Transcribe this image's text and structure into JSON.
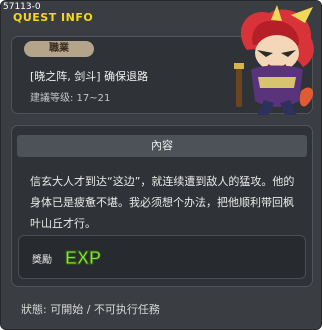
{
  "window": {
    "top_id": "57113-0",
    "title": "QUEST INFO"
  },
  "job": {
    "badge": "職業",
    "quest_name": "[晓之阵, 剑斗] 确保退路",
    "level_range": "建議等级: 17~21"
  },
  "content": {
    "header": "內容",
    "body": "信玄大人才到达“这边”，就连续遭到敌人的猛攻。他的身体已是疲惫不堪。我必须想个办法，把他顺利带回枫叶山丘才行。"
  },
  "reward": {
    "label": "獎勵",
    "exp_text": "EXP"
  },
  "status": {
    "text": "狀態: 可開始 / 不可执行任務"
  },
  "colors": {
    "title": "#f6d71d",
    "exp": "#8ee03a"
  },
  "icons": {
    "character": "samurai-warrior-icon",
    "exp": "exp-icon"
  }
}
